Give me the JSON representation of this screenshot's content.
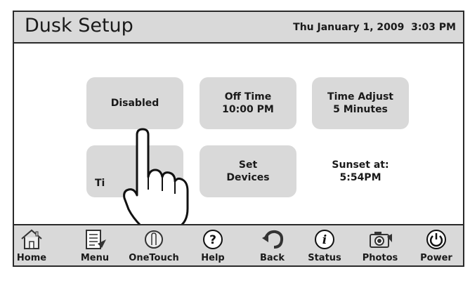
{
  "header": {
    "title": "Dusk Setup",
    "datetime": "Thu January 1, 2009  3:03 PM"
  },
  "tiles": {
    "mode": {
      "line1": "Disabled"
    },
    "off_time": {
      "line1": "Off Time",
      "line2": "10:00 PM"
    },
    "time_adjust": {
      "line1": "Time Adjust",
      "line2": "5 Minutes"
    },
    "timer": {
      "line1": "Ti"
    },
    "set_devices": {
      "line1": "Set",
      "line2": "Devices"
    }
  },
  "sunset": {
    "line1": "Sunset at:",
    "line2": "5:54PM"
  },
  "toolbar": {
    "items": [
      {
        "label": "Home",
        "icon": "home-icon"
      },
      {
        "label": "Menu",
        "icon": "menu-icon"
      },
      {
        "label": "OneTouch",
        "icon": "onetouch-icon"
      },
      {
        "label": "Help",
        "icon": "help-icon"
      },
      {
        "label": "Back",
        "icon": "back-icon"
      },
      {
        "label": "Status",
        "icon": "status-icon"
      },
      {
        "label": "Photos",
        "icon": "camera-icon"
      },
      {
        "label": "Power",
        "icon": "power-icon"
      }
    ]
  },
  "colors": {
    "panel": "#d9d9d9",
    "border": "#2a2a2a",
    "text": "#1a1a1a"
  }
}
